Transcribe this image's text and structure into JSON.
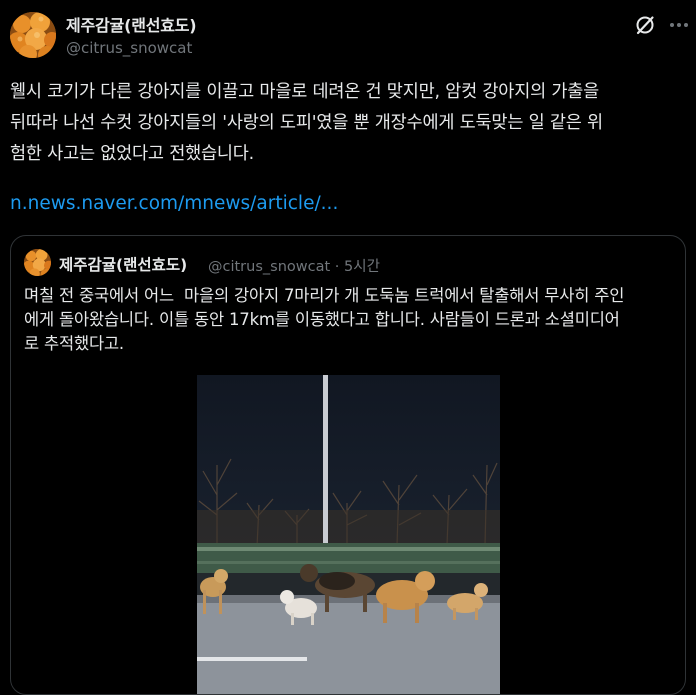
{
  "author": {
    "display_name": "제주감귤(랜선효도)",
    "handle": "@citrus_snowcat"
  },
  "icons": {
    "grok": "grok-icon",
    "more": "more-options-icon"
  },
  "tweet": {
    "text": "웰시 코기가 다른 강아지를 이끌고 마을로 데려온 건 맞지만, 암컷 강아지의 가출을\n뒤따라 나선 수컷 강아지들의 '사랑의 도피'였을 뿐 개장수에게 도둑맞는 일 같은 위\n험한 사고는 없었다고 전했습니다.",
    "link": "n.news.naver.com/mnews/article/..."
  },
  "quoted": {
    "display_name": "제주감귤(랜선효도)",
    "handle": "@citrus_snowcat",
    "separator": "·",
    "time": "5시간",
    "text": "며칠 전 중국에서 어느  마을의 강아지 7마리가 개 도둑놈 트럭에서 탈출해서 무사히 주인\n에게 돌아왔습니다. 이틀 동안 17km를 이동했다고 합니다. 사람들이 드론과 소셜미디어\n로 추적했다고."
  },
  "colors": {
    "background": "#000000",
    "text": "#e7e9ea",
    "secondary": "#71767b",
    "link": "#1d9bf0",
    "border": "#2f3336"
  }
}
